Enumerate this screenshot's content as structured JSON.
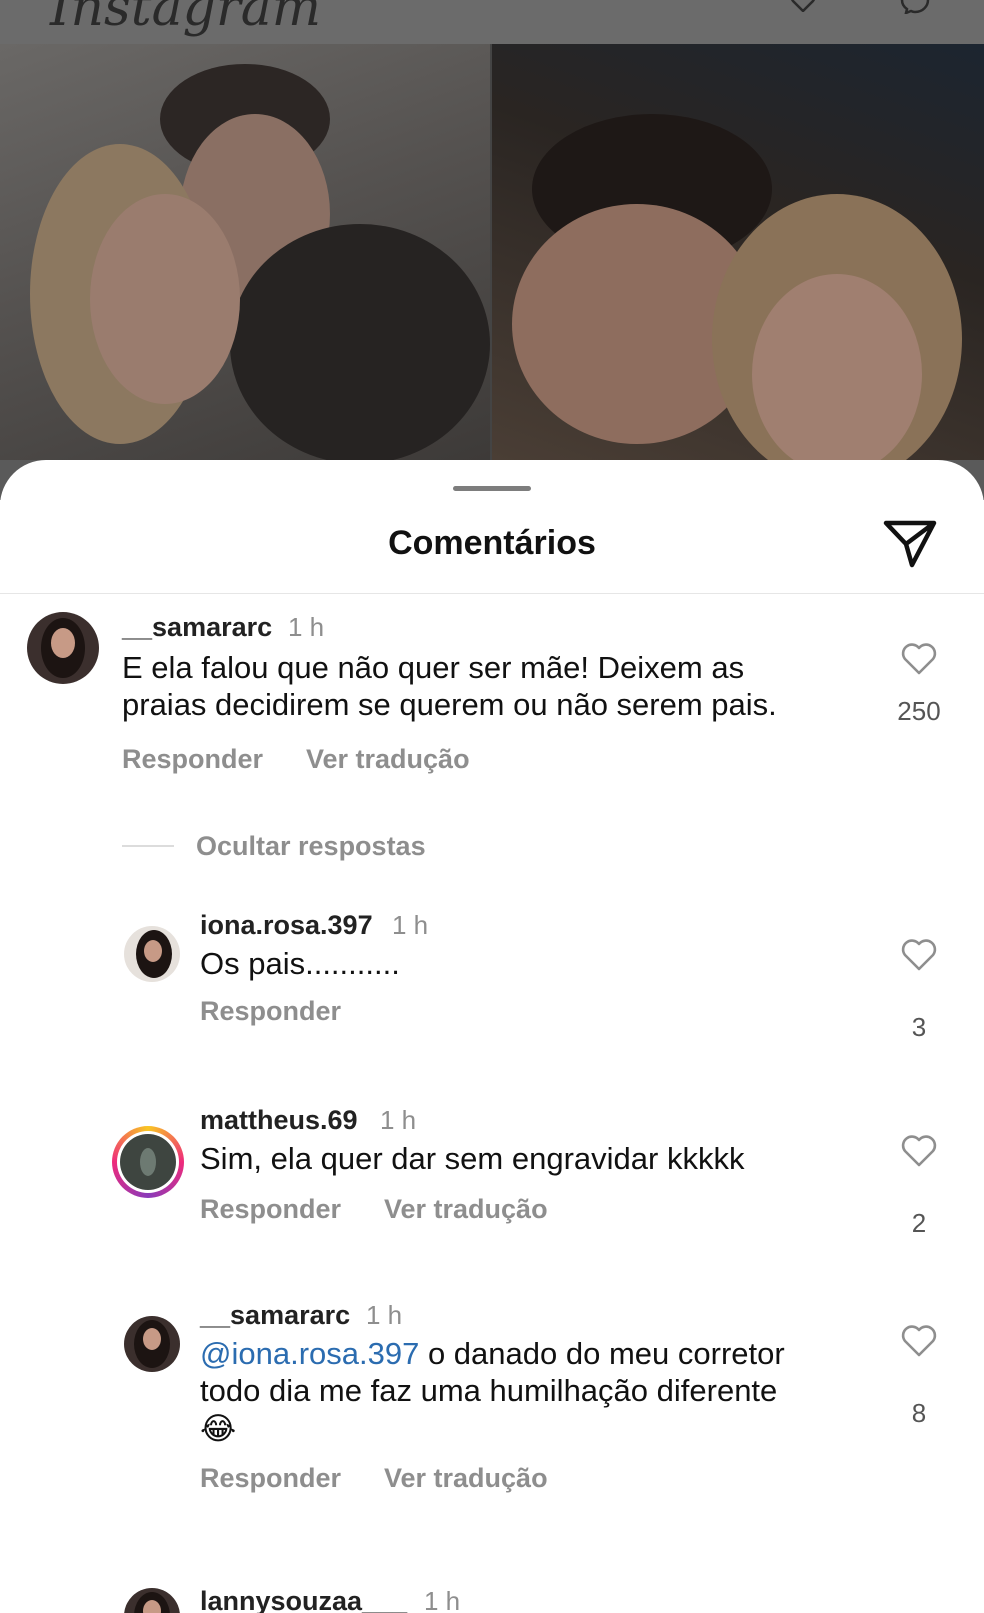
{
  "app": {
    "logo_text": "Instagram",
    "icons": [
      "heart-icon",
      "messenger-icon"
    ]
  },
  "sheet": {
    "title": "Comentários",
    "share_icon": "send-icon"
  },
  "comments": [
    {
      "username": "__samararc",
      "time": "1 h",
      "text_lines": [
        "E ela falou que não quer ser mãe! Deixem as",
        "praias decidirem se querem ou não serem pais."
      ],
      "likes": "250",
      "actions": [
        "Responder",
        "Ver tradução"
      ],
      "hide_replies": "Ocultar respostas"
    },
    {
      "username": "iona.rosa.397",
      "time": "1 h",
      "text_lines": [
        "Os pais..........."
      ],
      "likes": "3",
      "actions": [
        "Responder"
      ]
    },
    {
      "username": "mattheus.69",
      "time": "1 h",
      "text_lines": [
        "Sim, ela quer dar sem engravidar kkkkk"
      ],
      "likes": "2",
      "actions": [
        "Responder",
        "Ver tradução"
      ]
    },
    {
      "username": "__samararc",
      "time": "1 h",
      "mention": "@iona.rosa.397",
      "text_lines": [
        " o danado do meu corretor",
        "todo dia me faz uma humilhação diferente"
      ],
      "emoji": "😂",
      "likes": "8",
      "actions": [
        "Responder",
        "Ver tradução"
      ]
    },
    {
      "username": "lannysouzaa___",
      "time": "1 h"
    }
  ]
}
